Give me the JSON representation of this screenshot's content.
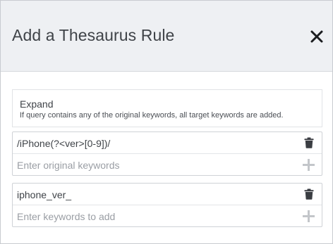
{
  "dialog": {
    "title": "Add a Thesaurus Rule",
    "close_icon": "close-icon"
  },
  "rule_type": {
    "name": "Expand",
    "description": "If query contains any of the original keywords, all target keywords are added."
  },
  "original_keywords": {
    "entries": [
      "/iPhone(?<ver>[0-9])/"
    ],
    "placeholder": "Enter original keywords",
    "delete_icon": "trash-icon",
    "add_icon": "plus-icon"
  },
  "target_keywords": {
    "entries": [
      "iphone_ver_"
    ],
    "placeholder": "Enter keywords to add",
    "delete_icon": "trash-icon",
    "add_icon": "plus-icon"
  },
  "colors": {
    "header_bg": "#eef0f3",
    "text": "#3f4348",
    "icon_dark": "#3a3d42",
    "icon_light": "#c3c6ca",
    "placeholder": "#9a9ea4"
  }
}
